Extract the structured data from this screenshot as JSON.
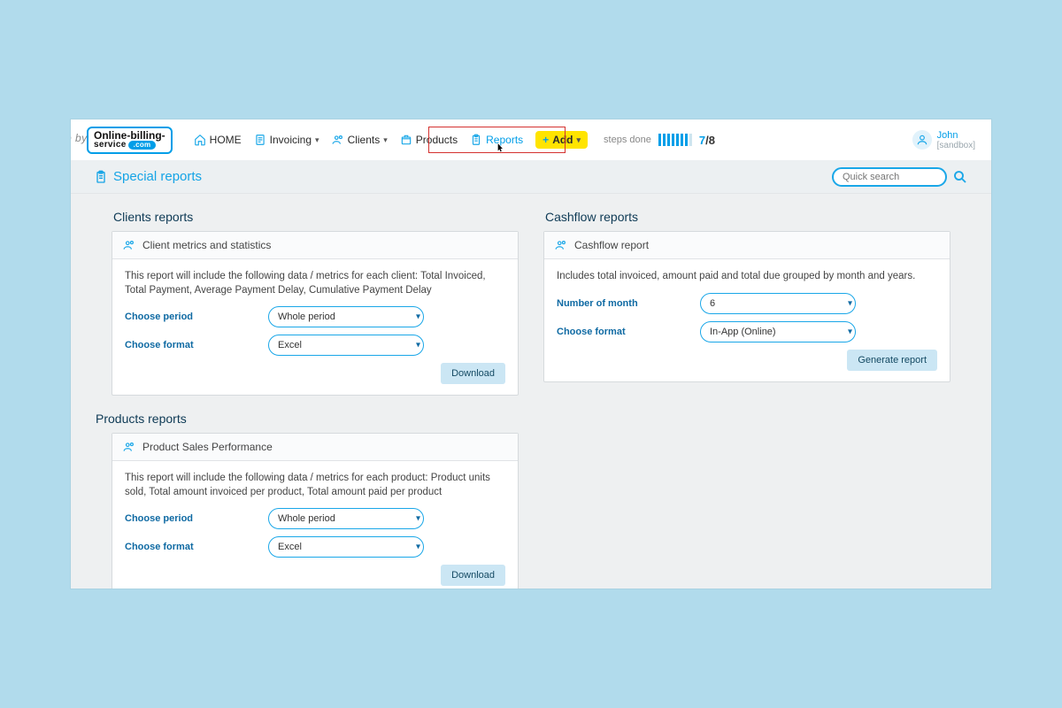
{
  "cropped_text": "p by",
  "logo": {
    "line1": "Online-billing-",
    "line2": "service",
    "pill": ".com"
  },
  "nav": {
    "home": "HOME",
    "invoicing": "Invoicing",
    "clients": "Clients",
    "products": "Products",
    "reports": "Reports",
    "add": "Add"
  },
  "steps": {
    "label": "steps done",
    "done": 7,
    "total": 8
  },
  "user": {
    "name": "John",
    "context": "[sandbox]"
  },
  "page_title": "Special reports",
  "search": {
    "placeholder": "Quick search"
  },
  "sections": {
    "clients": {
      "heading": "Clients reports",
      "card": {
        "title": "Client metrics and statistics",
        "desc": "This report will include the following data / metrics for each client: Total Invoiced, Total Payment, Average Payment Delay, Cumulative Payment Delay",
        "period_label": "Choose period",
        "period_value": "Whole period",
        "format_label": "Choose format",
        "format_value": "Excel",
        "action": "Download"
      }
    },
    "products": {
      "heading": "Products reports",
      "card": {
        "title": "Product Sales Performance",
        "desc": "This report will include the following data / metrics for each product: Product units sold, Total amount invoiced per product, Total amount paid per product",
        "period_label": "Choose period",
        "period_value": "Whole period",
        "format_label": "Choose format",
        "format_value": "Excel",
        "action": "Download"
      }
    },
    "cashflow": {
      "heading": "Cashflow reports",
      "card": {
        "title": "Cashflow report",
        "desc": "Includes total invoiced, amount paid and total due grouped by month and years.",
        "months_label": "Number of month",
        "months_value": "6",
        "format_label": "Choose format",
        "format_value": "In-App (Online)",
        "action": "Generate report"
      }
    }
  }
}
